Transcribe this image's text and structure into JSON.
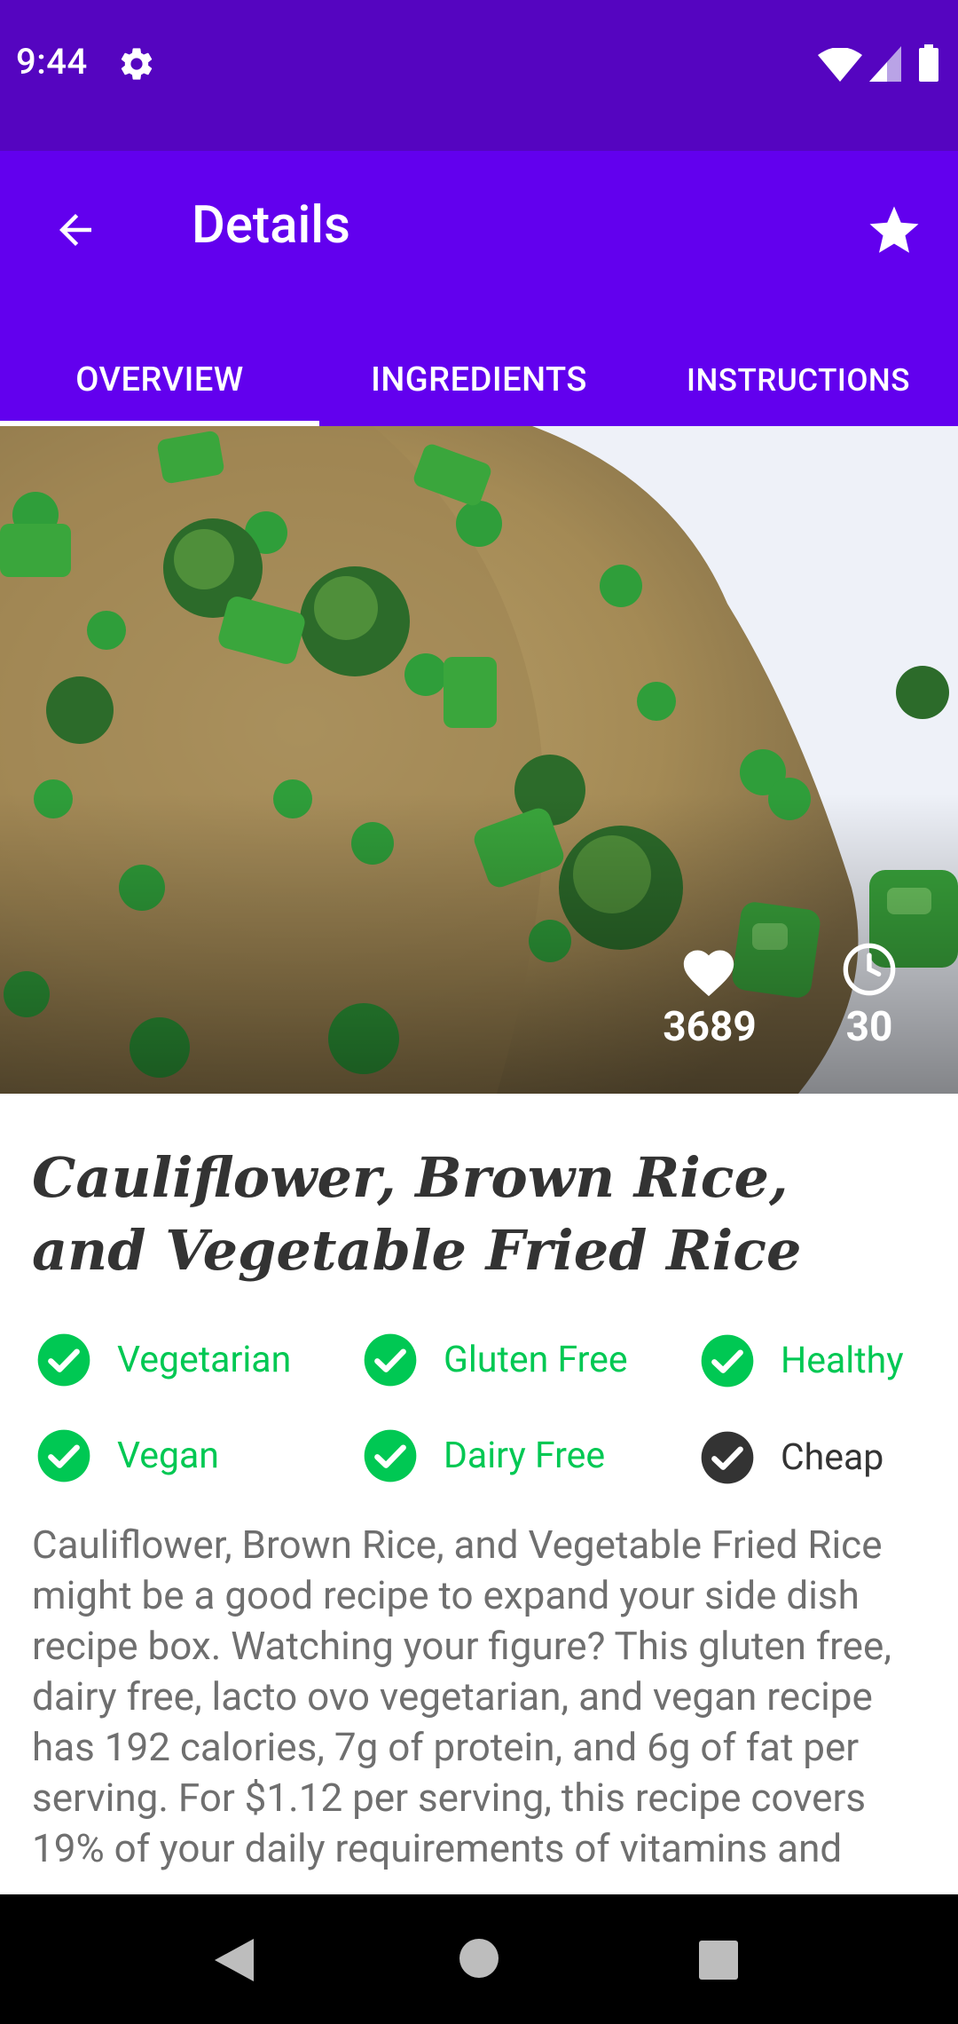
{
  "status_bar": {
    "time": "9:44"
  },
  "app_bar": {
    "title": "Details"
  },
  "tabs": [
    {
      "label": "OVERVIEW",
      "selected": true
    },
    {
      "label": "INGREDIENTS",
      "selected": false
    },
    {
      "label": "INSTRUCTIONS",
      "selected": false
    }
  ],
  "stats": {
    "likes": "3689",
    "minutes": "30"
  },
  "recipe": {
    "title": "Cauliflower, Brown Rice, and Vegetable Fried Rice",
    "summary": "Cauliflower, Brown Rice, and Vegetable Fried Rice might be a good recipe to expand your side dish recipe box. Watching your figure? This gluten free, dairy free, lacto ovo vegetarian, and vegan recipe has 192 calories, 7g of protein, and 6g of fat per serving. For $1.12 per serving, this recipe covers 19% of your daily requirements of vitamins and"
  },
  "tags": [
    {
      "label": "Vegetarian",
      "active": true
    },
    {
      "label": "Gluten Free",
      "active": true
    },
    {
      "label": "Healthy",
      "active": true
    },
    {
      "label": "Vegan",
      "active": true
    },
    {
      "label": "Dairy Free",
      "active": true
    },
    {
      "label": "Cheap",
      "active": false
    }
  ],
  "colors": {
    "status_bar": "#5505c0",
    "app_bar": "#6200ee",
    "tag_active": "#00c853",
    "tag_inactive": "#333333"
  },
  "icons": {
    "back": "arrow-left-icon",
    "favorite": "star-icon",
    "likes": "heart-icon",
    "time": "clock-icon",
    "tag_check": "check-circle-icon"
  }
}
